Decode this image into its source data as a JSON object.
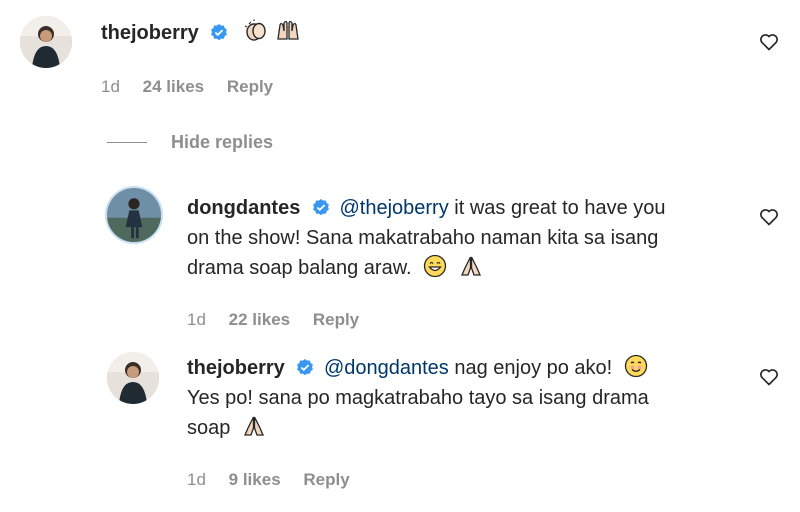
{
  "comment": {
    "username": "thejoberry",
    "emojis": [
      "clapping-hands-emoji",
      "raising-hands-emoji"
    ],
    "time": "1d",
    "likes": "24 likes",
    "reply": "Reply"
  },
  "hide_replies": "Hide replies",
  "reply1": {
    "username": "dongdantes",
    "mention": "@thejoberry",
    "text_line1": " it was great to have you",
    "text_line2": "on the show! Sana makatrabaho naman kita sa isang",
    "text_line3": "drama soap balang araw.",
    "time": "1d",
    "likes": "22 likes",
    "reply": "Reply"
  },
  "reply2": {
    "username": "thejoberry",
    "mention": "@dongdantes",
    "text_line1": " nag enjoy po ako!",
    "text_line2": "Yes po! sana po magkatrabaho tayo sa isang drama",
    "text_line3": "soap",
    "time": "1d",
    "likes": "9 likes",
    "reply": "Reply"
  },
  "colors": {
    "verified": "#3897f0",
    "mention": "#00376b",
    "meta": "#8e8e8e"
  }
}
